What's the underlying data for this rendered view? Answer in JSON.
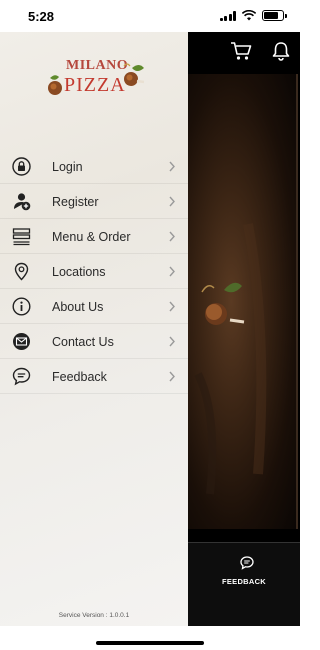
{
  "status_bar": {
    "time": "5:28"
  },
  "drawer": {
    "logo": {
      "line1": "MILANO",
      "line2": "PIZZA"
    },
    "menu_items": [
      {
        "label": "Login",
        "icon": "lock-icon"
      },
      {
        "label": "Register",
        "icon": "add-user-icon"
      },
      {
        "label": "Menu & Order",
        "icon": "menu-list-icon"
      },
      {
        "label": "Locations",
        "icon": "location-pin-icon"
      },
      {
        "label": "About Us",
        "icon": "info-icon"
      },
      {
        "label": "Contact Us",
        "icon": "mail-icon"
      },
      {
        "label": "Feedback",
        "icon": "feedback-chat-icon"
      }
    ],
    "service_version": "Service Version : 1.0.0.1"
  },
  "background_app": {
    "header_icons": [
      "cart-icon",
      "bell-icon"
    ],
    "bottom_tab": {
      "label": "FEEDBACK",
      "icon": "feedback-chat-icon"
    }
  }
}
